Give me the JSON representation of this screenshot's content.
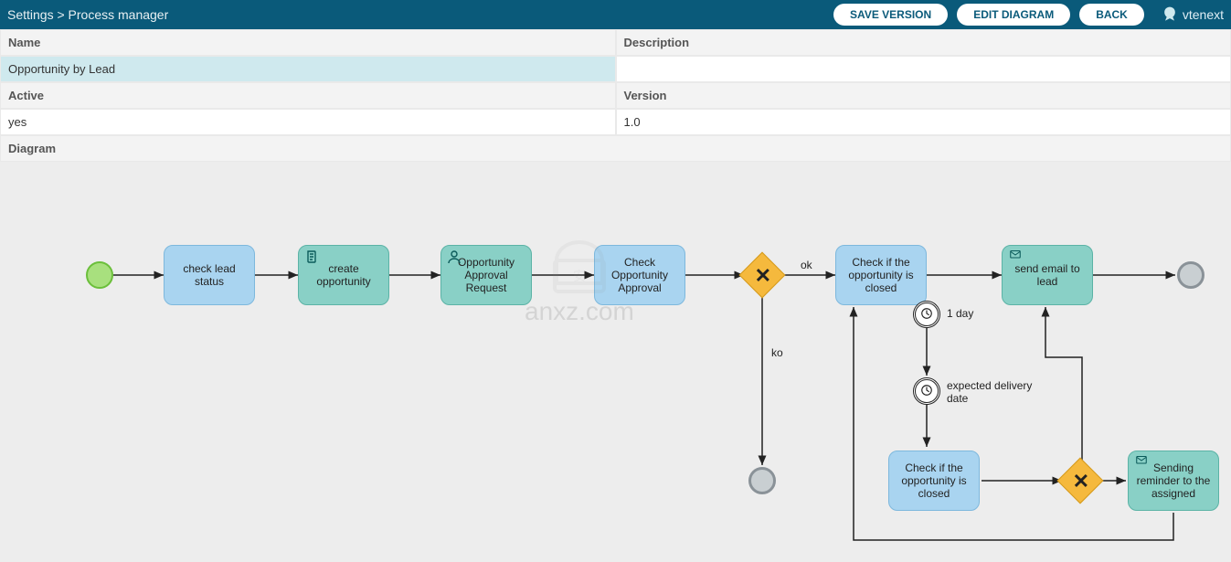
{
  "header": {
    "breadcrumb": "Settings > Process manager",
    "buttons": {
      "save": "SAVE VERSION",
      "edit": "EDIT DIAGRAM",
      "back": "BACK"
    },
    "brand": "vtenext"
  },
  "details": {
    "name_label": "Name",
    "name_value": "Opportunity by Lead",
    "description_label": "Description",
    "description_value": "",
    "active_label": "Active",
    "active_value": "yes",
    "version_label": "Version",
    "version_value": "1.0",
    "diagram_label": "Diagram"
  },
  "diagram": {
    "nodes": {
      "start": {
        "type": "start-event"
      },
      "check_lead_status": {
        "type": "task-blue",
        "label": "check lead status"
      },
      "create_opportunity": {
        "type": "task-teal",
        "label": "create opportunity",
        "icon": "script-icon"
      },
      "opportunity_approval_request": {
        "type": "task-teal",
        "label": "Opportunity Approval Request",
        "icon": "user-icon"
      },
      "check_opportunity_approval": {
        "type": "task-blue",
        "label": "Check Opportunity Approval"
      },
      "gateway1": {
        "type": "gateway-exclusive"
      },
      "check_if_closed_top": {
        "type": "task-blue",
        "label": "Check if the opportunity is closed"
      },
      "send_email_to_lead": {
        "type": "task-teal",
        "label": "send email to lead",
        "icon": "mail-icon"
      },
      "end_top": {
        "type": "end-event"
      },
      "end_ko": {
        "type": "end-event"
      },
      "timer_1day": {
        "type": "timer",
        "label": "1 day"
      },
      "timer_expected": {
        "type": "timer",
        "label": "expected delivery date"
      },
      "check_if_closed_bottom": {
        "type": "task-blue",
        "label": "Check if the opportunity is closed"
      },
      "gateway2": {
        "type": "gateway-exclusive"
      },
      "sending_reminder": {
        "type": "task-teal",
        "label": "Sending reminder to the assigned",
        "icon": "mail-icon"
      }
    },
    "edges": {
      "ok": "ok",
      "ko": "ko",
      "t1": "1 day",
      "t2": "expected delivery date"
    }
  },
  "watermark": "anxz.com"
}
